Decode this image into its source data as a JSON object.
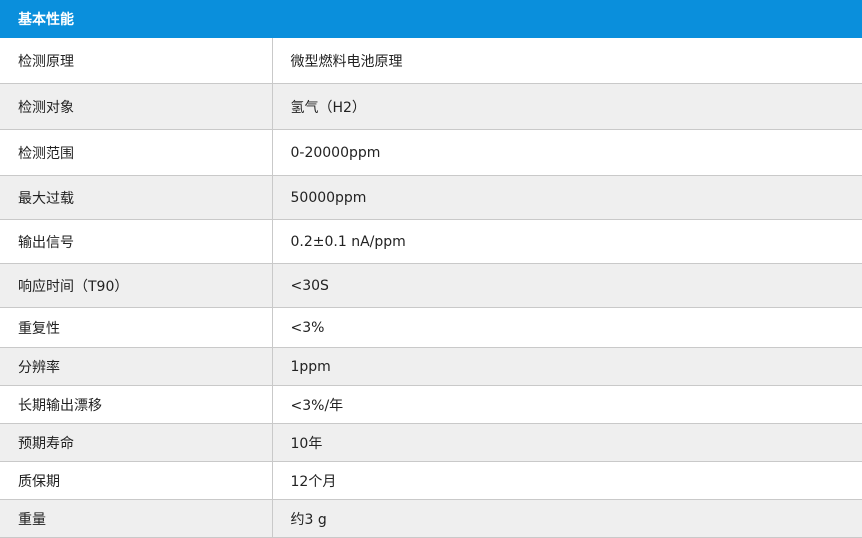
{
  "section_title": "基本性能",
  "rows": [
    {
      "label": "检测原理",
      "value": "微型燃料电池原理"
    },
    {
      "label": "检测对象",
      "value": "氢气（H2）"
    },
    {
      "label": "检测范围",
      "value": "0-20000ppm"
    },
    {
      "label": "最大过载",
      "value": "50000ppm"
    },
    {
      "label": "输出信号",
      "value": "0.2±0.1 nA/ppm"
    },
    {
      "label": "响应时间（T90）",
      "value": "<30S"
    },
    {
      "label": "重复性",
      "value": "<3%"
    },
    {
      "label": "分辨率",
      "value": "1ppm"
    },
    {
      "label": "长期输出漂移",
      "value": "<3%/年"
    },
    {
      "label": "预期寿命",
      "value": "10年"
    },
    {
      "label": "质保期",
      "value": "12个月"
    },
    {
      "label": "重量",
      "value": "约3 g"
    }
  ],
  "colors": {
    "header_bg": "#0a8fdc",
    "header_text": "#ffffff",
    "row_alt_bg": "#efefef",
    "border": "#c9c9c9"
  }
}
